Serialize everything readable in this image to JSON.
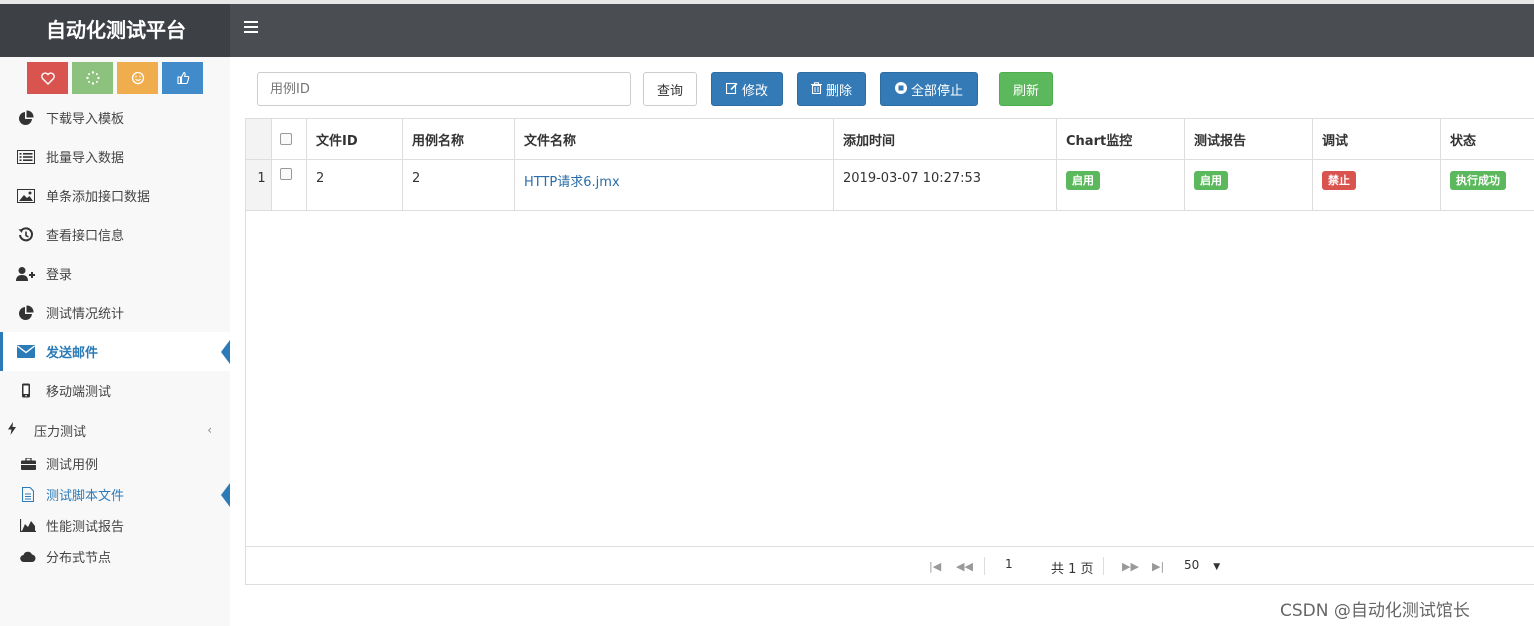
{
  "header": {
    "title": "自动化测试平台"
  },
  "sidebar": {
    "shortcut_colors": [
      "#d9534f",
      "#8cc17e",
      "#f0ad4e",
      "#428bca"
    ],
    "items": [
      {
        "label": "下载导入模板",
        "icon": "pie-chart-icon"
      },
      {
        "label": "批量导入数据",
        "icon": "list-icon"
      },
      {
        "label": "单条添加接口数据",
        "icon": "image-icon"
      },
      {
        "label": "查看接口信息",
        "icon": "history-icon"
      },
      {
        "label": "登录",
        "icon": "user-plus-icon"
      },
      {
        "label": "测试情况统计",
        "icon": "pie-chart-icon"
      },
      {
        "label": "发送邮件",
        "icon": "envelope-icon"
      },
      {
        "label": "移动端测试",
        "icon": "mobile-icon"
      }
    ],
    "group": {
      "label": "压力测试",
      "icon": "bolt-icon"
    },
    "subitems": [
      {
        "label": "测试用例",
        "icon": "briefcase-icon"
      },
      {
        "label": "测试脚本文件",
        "icon": "file-icon"
      },
      {
        "label": "性能测试报告",
        "icon": "area-chart-icon"
      },
      {
        "label": "分布式节点",
        "icon": "cloud-icon"
      }
    ]
  },
  "toolbar": {
    "search_placeholder": "用例ID",
    "query_label": "查询",
    "edit_label": "修改",
    "delete_label": "删除",
    "stop_all_label": "全部停止",
    "refresh_label": "刷新"
  },
  "table": {
    "columns": [
      "文件ID",
      "用例名称",
      "文件名称",
      "添加时间",
      "Chart监控",
      "测试报告",
      "调试",
      "状态"
    ],
    "rows": [
      {
        "num": "1",
        "file_id": "2",
        "case_name": "2",
        "file_name": "HTTP请求6.jmx",
        "added": "2019-03-07 10:27:53",
        "chart": "启用",
        "report": "启用",
        "debug": "禁止",
        "status": "执行成功"
      }
    ]
  },
  "pager": {
    "page": "1",
    "total": "共 1 页",
    "size": "50"
  },
  "watermark": "CSDN @自动化测试馆长"
}
